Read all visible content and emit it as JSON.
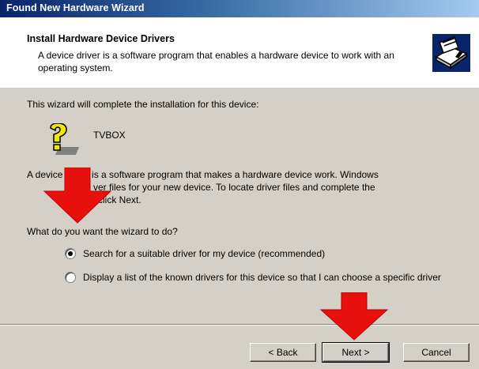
{
  "window": {
    "title": "Found New Hardware Wizard"
  },
  "header": {
    "title": "Install Hardware Device Drivers",
    "subtitle": "A device driver is a software program that enables a hardware device to work with an operating system."
  },
  "body": {
    "intro": "This wizard will complete the installation for this device:",
    "device_name": "TVBOX",
    "description_line1": "A device driver is a software program that makes a hardware device work. Windows",
    "description_line2": "ver files for your new device. To locate driver files and complete the",
    "description_line3": "click Next.",
    "question": "What do you want the wizard to do?",
    "options": [
      {
        "label": "Search for a suitable driver for my device (recommended)",
        "checked": true
      },
      {
        "label": "Display a list of the known drivers for this device so that I can choose a specific driver",
        "checked": false
      }
    ]
  },
  "footer": {
    "back_label": "< Back",
    "next_label": "Next >",
    "cancel_label": "Cancel"
  },
  "colors": {
    "title_gradient_start": "#0a246a",
    "dialog_face": "#d4d0c8",
    "arrow_red": "#e8100c"
  },
  "icons": {
    "header": "hardware-install-icon",
    "device": "unknown-device-question-icon",
    "annotation": "red-down-arrow"
  }
}
